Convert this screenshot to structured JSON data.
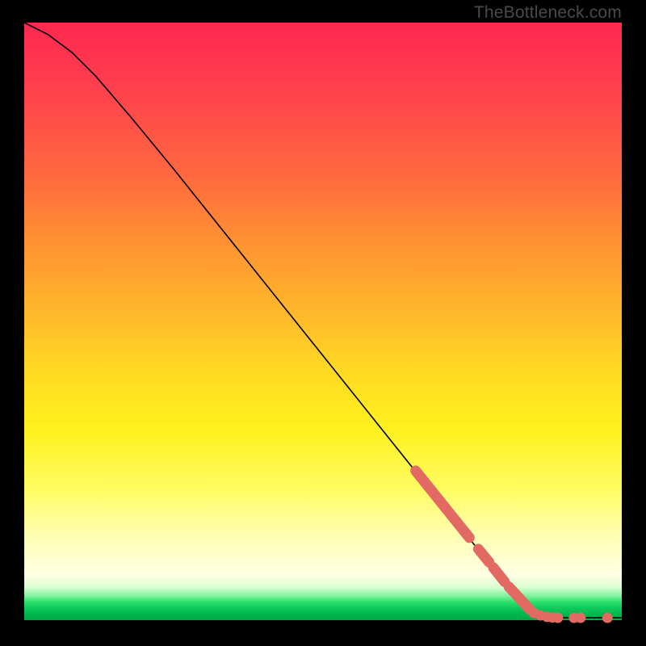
{
  "watermark": "TheBottleneck.com",
  "chart_data": {
    "type": "line",
    "title": "",
    "xlabel": "",
    "ylabel": "",
    "xlim": [
      0,
      100
    ],
    "ylim": [
      0,
      100
    ],
    "grid": false,
    "legend": false,
    "curve": [
      {
        "x": 0,
        "y": 100
      },
      {
        "x": 4,
        "y": 98
      },
      {
        "x": 8,
        "y": 95
      },
      {
        "x": 12,
        "y": 91
      },
      {
        "x": 18,
        "y": 84
      },
      {
        "x": 25,
        "y": 75.5
      },
      {
        "x": 35,
        "y": 63
      },
      {
        "x": 45,
        "y": 50.5
      },
      {
        "x": 55,
        "y": 38
      },
      {
        "x": 65,
        "y": 25.5
      },
      {
        "x": 75,
        "y": 13
      },
      {
        "x": 82,
        "y": 4.5
      },
      {
        "x": 85,
        "y": 1.5
      },
      {
        "x": 87,
        "y": 0.6
      },
      {
        "x": 90,
        "y": 0.4
      },
      {
        "x": 95,
        "y": 0.4
      },
      {
        "x": 100,
        "y": 0.4
      }
    ],
    "marker_segments": [
      {
        "x1": 65.5,
        "y1": 25.0,
        "x2": 74.5,
        "y2": 13.8
      },
      {
        "x1": 76.0,
        "y1": 11.9,
        "x2": 77.8,
        "y2": 9.7
      },
      {
        "x1": 78.5,
        "y1": 8.8,
        "x2": 80.4,
        "y2": 6.4
      },
      {
        "x1": 81.1,
        "y1": 5.6,
        "x2": 84.6,
        "y2": 1.8
      }
    ],
    "tail_points": [
      {
        "x": 85.3,
        "y": 1.2
      },
      {
        "x": 86.4,
        "y": 0.8
      },
      {
        "x": 87.5,
        "y": 0.55
      },
      {
        "x": 88.4,
        "y": 0.45
      },
      {
        "x": 89.3,
        "y": 0.4
      },
      {
        "x": 92.0,
        "y": 0.4
      },
      {
        "x": 93.1,
        "y": 0.4
      },
      {
        "x": 97.6,
        "y": 0.4
      }
    ],
    "marker_color": "#e26a63",
    "curve_color": "#000000"
  }
}
